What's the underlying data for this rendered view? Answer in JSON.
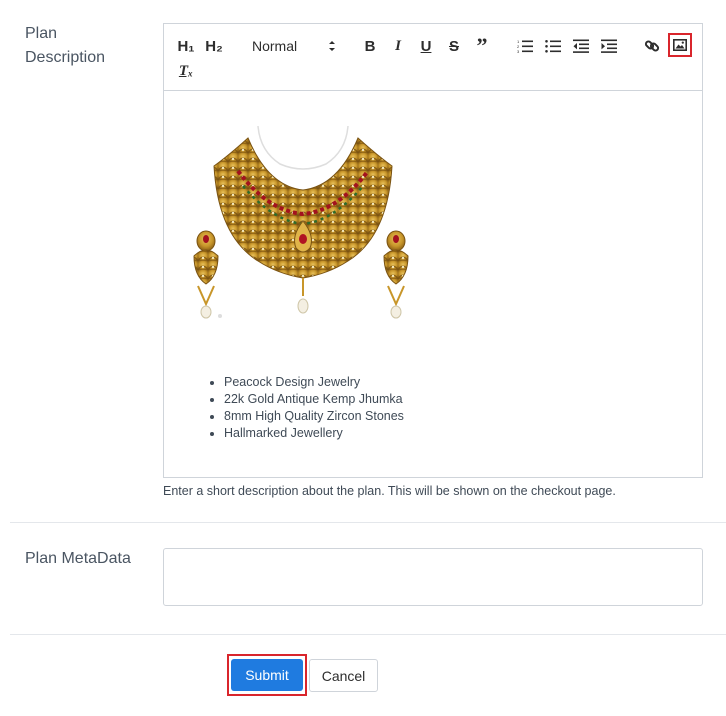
{
  "plan_description": {
    "label": "Plan Description",
    "toolbar": {
      "h1_label": "H₁",
      "h2_label": "H₂",
      "format_value": "Normal",
      "bold_label": "B",
      "italic_label": "I",
      "underline_label": "U",
      "strike_label": "S",
      "quote_label": "”",
      "clear_label": "Tₓ"
    },
    "bullets": [
      "Peacock Design Jewelry",
      "22k Gold Antique Kemp Jhumka",
      "8mm High Quality Zircon Stones",
      "Hallmarked Jewellery"
    ],
    "help_text": "Enter a short description about the plan. This will be shown on the checkout page."
  },
  "plan_metadata": {
    "label": "Plan MetaData",
    "value": ""
  },
  "actions": {
    "submit_label": "Submit",
    "cancel_label": "Cancel"
  },
  "colors": {
    "accent": "#1f7be0",
    "highlight": "#d9252c",
    "gold": "#c8962a"
  }
}
